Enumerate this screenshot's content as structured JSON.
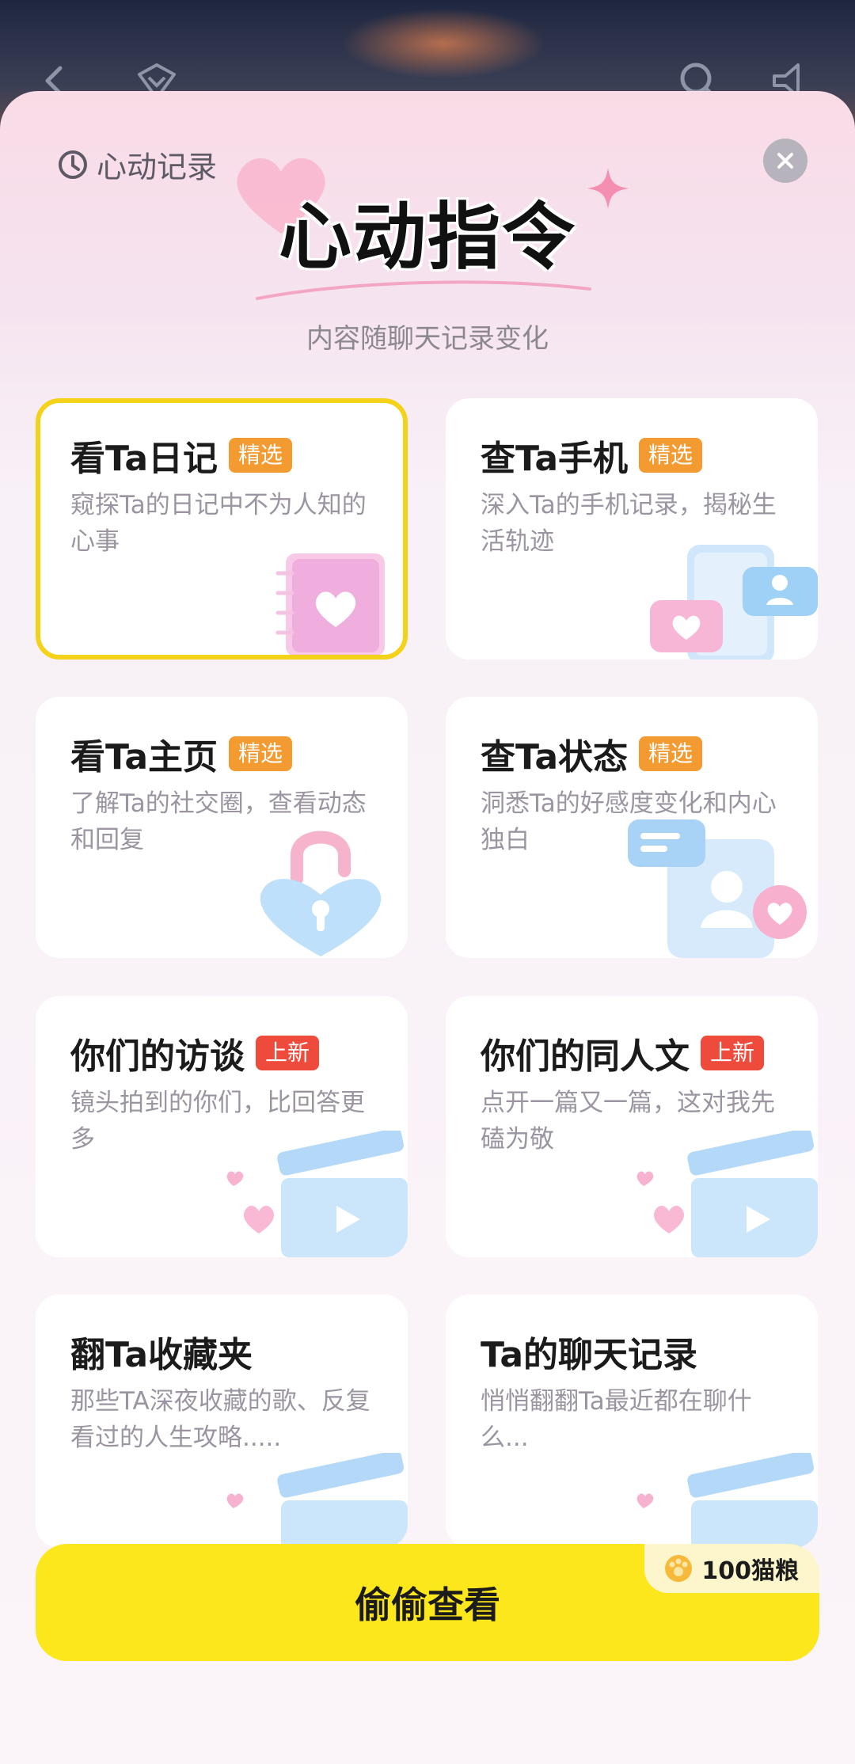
{
  "header": {
    "history_label": "心动记录",
    "title": "心动指令",
    "subtitle": "内容随聊天记录变化"
  },
  "cards": [
    {
      "title": "看Ta日记",
      "badge": "精选",
      "badge_color": "#f39a30",
      "desc": "窥探Ta的日记中不为人知的心事",
      "selected": true
    },
    {
      "title": "查Ta手机",
      "badge": "精选",
      "badge_color": "#f39a30",
      "desc": "深入Ta的手机记录，揭秘生活轨迹",
      "selected": false
    },
    {
      "title": "看Ta主页",
      "badge": "精选",
      "badge_color": "#f39a30",
      "desc": "了解Ta的社交圈，查看动态和回复",
      "selected": false
    },
    {
      "title": "查Ta状态",
      "badge": "精选",
      "badge_color": "#f39a30",
      "desc": "洞悉Ta的好感度变化和内心独白",
      "selected": false
    },
    {
      "title": "你们的访谈",
      "badge": "上新",
      "badge_color": "#ef4b3c",
      "desc": "镜头拍到的你们，比回答更多",
      "selected": false
    },
    {
      "title": "你们的同人文",
      "badge": "上新",
      "badge_color": "#ef4b3c",
      "desc": "点开一篇又一篇，这对我先磕为敬",
      "selected": false
    },
    {
      "title": "翻Ta收藏夹",
      "badge": "",
      "desc": "那些TA深夜收藏的歌、反复看过的人生攻略.....",
      "selected": false
    },
    {
      "title": "Ta的聊天记录",
      "badge": "",
      "desc": "悄悄翻翻Ta最近都在聊什么...",
      "selected": false
    }
  ],
  "action": {
    "label": "偷偷查看",
    "price": "100猫粮"
  },
  "colors": {
    "accent_yellow": "#fbe71b",
    "badge_orange": "#f39a30",
    "badge_red": "#ef4b3c"
  }
}
